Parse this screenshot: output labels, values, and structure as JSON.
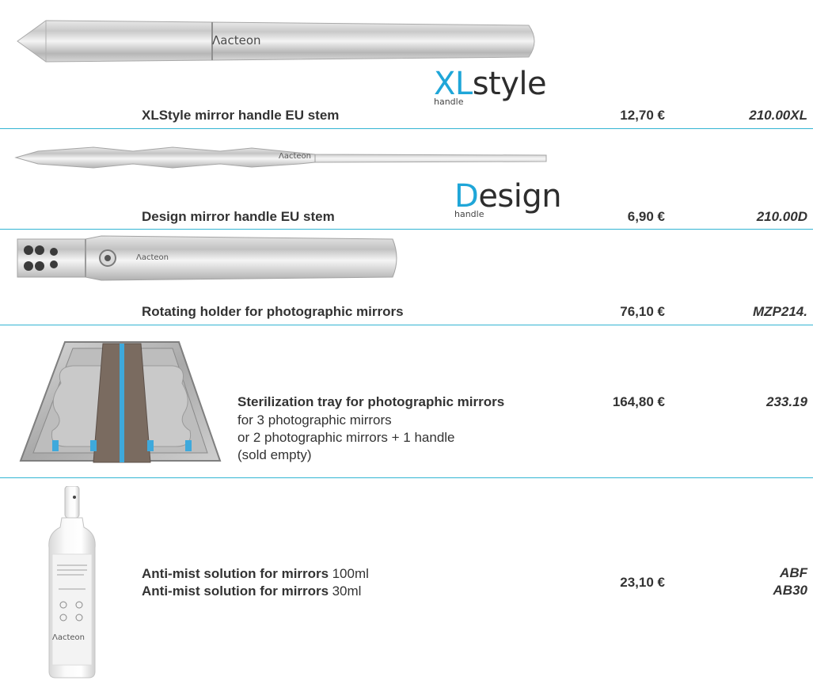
{
  "colors": {
    "accent": "#1fa6d8",
    "divider": "#33b5d3",
    "text": "#333333"
  },
  "products": [
    {
      "name": "XLStyle mirror handle EU stem",
      "price": "12,70 €",
      "ref": "210.00XL",
      "image": "xlstyle-handle-image",
      "brand": "acteon",
      "logo": {
        "accent": "XL",
        "rest": "style",
        "sub": "handle"
      }
    },
    {
      "name": "Design mirror handle EU stem",
      "price": "6,90 €",
      "ref": "210.00D",
      "image": "design-handle-image",
      "brand": "acteon",
      "logo": {
        "accent": "D",
        "rest": "esign",
        "sub": "handle"
      }
    },
    {
      "name": "Rotating holder for photographic mirrors",
      "price": "76,10 €",
      "ref": "MZP214.",
      "image": "rotating-holder-image",
      "brand": "acteon"
    },
    {
      "name": "Sterilization tray for photographic mirrors",
      "details": [
        "for 3 photographic mirrors",
        "or 2 photographic mirrors + 1 handle",
        "(sold empty)"
      ],
      "price": "164,80 €",
      "ref": "233.19",
      "image": "sterilization-tray-image"
    },
    {
      "lines": [
        {
          "name": "Anti-mist solution for mirrors",
          "size": "100ml",
          "ref": "ABF"
        },
        {
          "name": "Anti-mist solution for mirrors",
          "size": "30ml",
          "ref": "AB30"
        }
      ],
      "price": "23,10 €",
      "image": "anti-mist-bottle-image",
      "brand": "acteon"
    }
  ]
}
